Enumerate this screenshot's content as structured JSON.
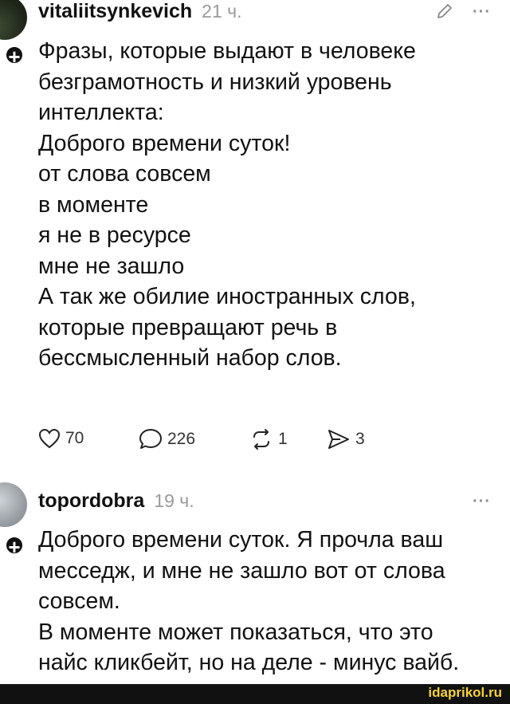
{
  "posts": [
    {
      "username": "vitaliitsynkevich",
      "time": "21 ч.",
      "more": "···",
      "lines": [
        "Фразы, которые выдают в человеке",
        "безграмотность и низкий уровень",
        "интеллекта:",
        "Доброго времени суток!",
        "от слова совсем",
        "в моменте",
        "я не в ресурсе",
        "мне не зашло",
        "А так же обилие иностранных слов,",
        "которые превращают речь в",
        "бессмысленный набор слов."
      ],
      "actions": {
        "likes": "70",
        "comments": "226",
        "reposts": "1",
        "shares": "3"
      }
    },
    {
      "username": "topordobra",
      "time": "19 ч.",
      "more": "···",
      "lines": [
        "Доброго времени суток. Я прочла ваш",
        "месседж, и мне не зашло вот от слова",
        "совсем.",
        "В моменте может показаться, что это",
        "найс кликбейт, но на деле - минус вайб."
      ]
    }
  ],
  "icons": [
    "plus-icon",
    "edit-icon",
    "more-icon",
    "heart-icon",
    "comment-icon",
    "repost-icon",
    "share-icon"
  ],
  "watermark": "idaprikol.ru",
  "colors": {
    "text": "#111111",
    "muted": "#9a9a9a",
    "watermark_bg": "#111111",
    "watermark_text": "#f5d23b"
  }
}
